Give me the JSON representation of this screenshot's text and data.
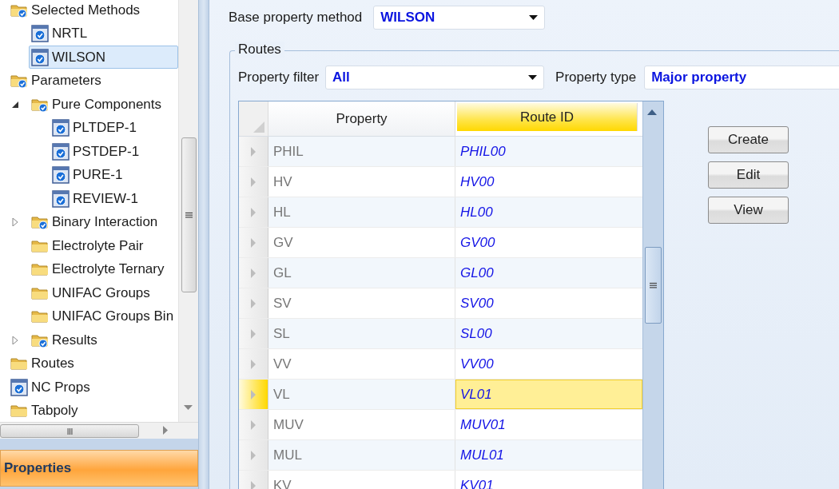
{
  "tree": [
    {
      "label": "Selected Methods",
      "kind": "folder-check",
      "children": [
        {
          "label": "NRTL",
          "kind": "form",
          "selected": false
        },
        {
          "label": "WILSON",
          "kind": "form",
          "selected": true
        }
      ]
    },
    {
      "label": "Parameters",
      "kind": "folder-check",
      "children": [
        {
          "label": "Pure Components",
          "kind": "folder-check",
          "expanded": true,
          "children": [
            {
              "label": "PLTDEP-1",
              "kind": "form",
              "selected": false
            },
            {
              "label": "PSTDEP-1",
              "kind": "form",
              "selected": false
            },
            {
              "label": "PURE-1",
              "kind": "form",
              "selected": false
            },
            {
              "label": "REVIEW-1",
              "kind": "form",
              "selected": false
            }
          ]
        },
        {
          "label": "Binary Interaction",
          "kind": "folder-check",
          "expanded": false
        },
        {
          "label": "Electrolyte Pair",
          "kind": "folder"
        },
        {
          "label": "Electrolyte Ternary",
          "kind": "folder"
        },
        {
          "label": "UNIFAC Groups",
          "kind": "folder"
        },
        {
          "label": "UNIFAC Groups Bin",
          "kind": "folder"
        },
        {
          "label": "Results",
          "kind": "folder-check",
          "expanded": false
        }
      ]
    },
    {
      "label": "Routes",
      "kind": "folder"
    },
    {
      "label": "NC Props",
      "kind": "form",
      "selected": false
    },
    {
      "label": "Tabpoly",
      "kind": "folder"
    }
  ],
  "properties_bar": {
    "label": "Properties"
  },
  "base_method": {
    "label": "Base property method",
    "value": "WILSON"
  },
  "routes": {
    "title": "Routes",
    "property_filter": {
      "label": "Property filter",
      "value": "All"
    },
    "property_type": {
      "label": "Property type",
      "value": "Major property"
    },
    "table": {
      "columns": [
        {
          "label": "Property",
          "selected": false
        },
        {
          "label": "Route ID",
          "selected": true
        }
      ],
      "rows": [
        {
          "property": "PHIL",
          "route_id": "PHIL00",
          "selected": false
        },
        {
          "property": "HV",
          "route_id": "HV00",
          "selected": false
        },
        {
          "property": "HL",
          "route_id": "HL00",
          "selected": false
        },
        {
          "property": "GV",
          "route_id": "GV00",
          "selected": false
        },
        {
          "property": "GL",
          "route_id": "GL00",
          "selected": false
        },
        {
          "property": "SV",
          "route_id": "SV00",
          "selected": false
        },
        {
          "property": "SL",
          "route_id": "SL00",
          "selected": false
        },
        {
          "property": "VV",
          "route_id": "VV00",
          "selected": false
        },
        {
          "property": "VL",
          "route_id": "VL01",
          "selected": true
        },
        {
          "property": "MUV",
          "route_id": "MUV01",
          "selected": false
        },
        {
          "property": "MUL",
          "route_id": "MUL01",
          "selected": false
        },
        {
          "property": "KV",
          "route_id": "KV01",
          "selected": false
        }
      ]
    },
    "buttons": [
      "Create",
      "Edit",
      "View"
    ]
  }
}
